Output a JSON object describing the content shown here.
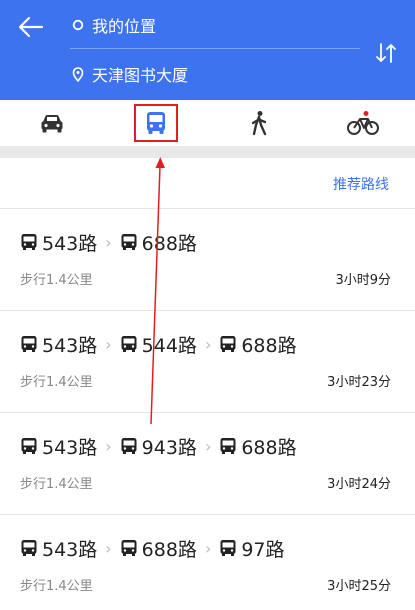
{
  "header": {
    "from": "我的位置",
    "to": "天津图书大厦",
    "back_icon": "arrow-left-icon",
    "swap_icon": "swap-vertical-icon"
  },
  "modes": [
    {
      "name": "drive",
      "icon": "car-icon",
      "selected": false
    },
    {
      "name": "bus",
      "icon": "bus-icon",
      "selected": true
    },
    {
      "name": "walk",
      "icon": "walk-icon",
      "selected": false
    },
    {
      "name": "bike",
      "icon": "bike-icon",
      "selected": false
    }
  ],
  "recommend_label": "推荐路线",
  "colors": {
    "header": "#3d73ee",
    "accent": "#3d73ee",
    "annotation": "#e02020"
  },
  "routes": [
    {
      "lines": [
        "543路",
        "688路"
      ],
      "walk": "步行1.4公里",
      "time": "3小时9分"
    },
    {
      "lines": [
        "543路",
        "544路",
        "688路"
      ],
      "walk": "步行1.4公里",
      "time": "3小时23分"
    },
    {
      "lines": [
        "543路",
        "943路",
        "688路"
      ],
      "walk": "步行1.4公里",
      "time": "3小时24分"
    },
    {
      "lines": [
        "543路",
        "688路",
        "97路"
      ],
      "walk": "步行1.4公里",
      "time": "3小时25分"
    }
  ]
}
